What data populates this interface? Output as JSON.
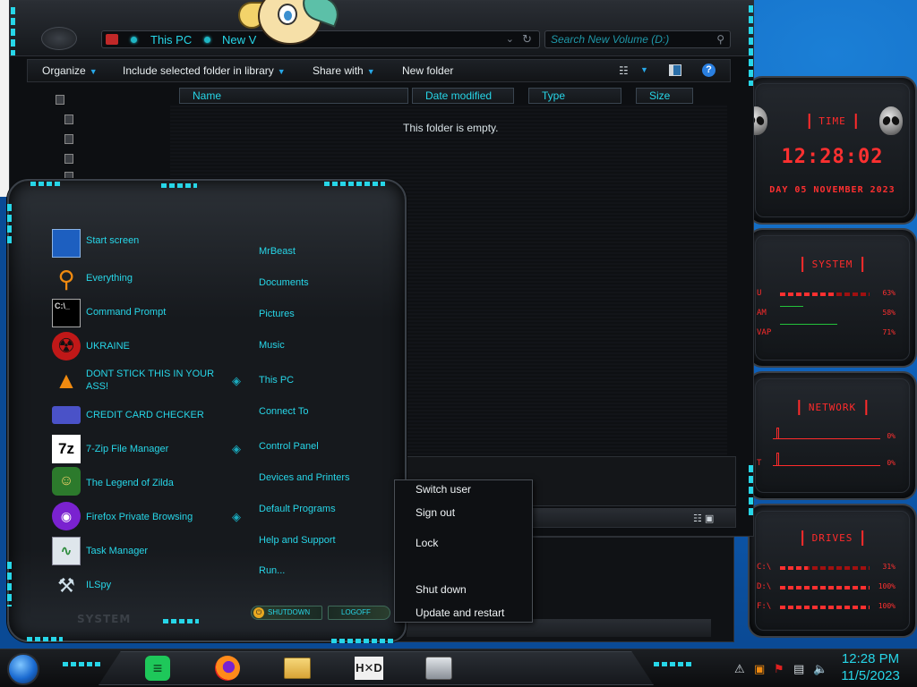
{
  "explorer": {
    "breadcrumb": [
      "This PC",
      "New V"
    ],
    "search_placeholder": "Search New Volume (D:)",
    "toolbar": {
      "organize": "Organize",
      "include_library": "Include selected folder in library",
      "share_with": "Share with",
      "new_folder": "New folder"
    },
    "columns": [
      "Name",
      "Date modified",
      "Type",
      "Size"
    ],
    "empty_message": "This folder is empty."
  },
  "start_menu": {
    "programs": [
      {
        "label": "Start screen",
        "icon": "start-screen-icon"
      },
      {
        "label": "Everything",
        "icon": "magnifier-icon"
      },
      {
        "label": "Command Prompt",
        "icon": "cmd-icon"
      },
      {
        "label": "UKRAINE",
        "icon": "radiation-icon"
      },
      {
        "label": "DONT STICK THIS IN YOUR ASS!",
        "icon": "vlc-cone-icon"
      },
      {
        "label": "CREDIT CARD CHECKER",
        "icon": "credit-card-icon"
      },
      {
        "label": "7-Zip File Manager",
        "icon": "7zip-icon"
      },
      {
        "label": "The Legend of Zilda",
        "icon": "zelda-icon"
      },
      {
        "label": "Firefox Private Browsing",
        "icon": "firefox-private-icon"
      },
      {
        "label": "Task Manager",
        "icon": "task-manager-icon"
      },
      {
        "label": "ILSpy",
        "icon": "ilspy-icon"
      }
    ],
    "places": [
      "MrBeast",
      "Documents",
      "Pictures",
      "Music",
      "This PC",
      "Connect To",
      "Control Panel",
      "Devices and Printers",
      "Default Programs",
      "Help and Support",
      "Run..."
    ],
    "system_label": "SYSTEM",
    "shutdown_label": "SHUTDOWN",
    "logoff_label": "LOGOFF"
  },
  "context_menu": {
    "items": [
      "Switch user",
      "Sign out",
      "Lock",
      "Shut down",
      "Update and restart"
    ]
  },
  "gadgets": {
    "time": {
      "title": "TIME",
      "clock": "12:28:02",
      "date": "DAY 05 NOVEMBER 2023"
    },
    "system": {
      "title": "SYSTEM",
      "rows": [
        {
          "label": "U",
          "pct_text": "63%",
          "value": 0.63
        },
        {
          "label": "AM",
          "pct_text": "58%",
          "value": 0.58
        },
        {
          "label": "VAP",
          "pct_text": "71%",
          "value": 0.71
        }
      ]
    },
    "network": {
      "title": "NETWORK",
      "rows": [
        {
          "pct_text": "0%"
        },
        {
          "label": "T",
          "pct_text": "0%"
        }
      ]
    },
    "drives": {
      "title": "DRIVES",
      "rows": [
        {
          "label": "C:\\",
          "pct_text": "31%",
          "value": 0.31
        },
        {
          "label": "D:\\",
          "pct_text": "100%",
          "value": 1.0
        },
        {
          "label": "F:\\",
          "pct_text": "100%",
          "value": 1.0
        }
      ]
    }
  },
  "taskbar": {
    "time": "12:28 PM",
    "date": "11/5/2023"
  },
  "colors": {
    "accent_cyan": "#27d6e8",
    "gadget_red": "#ff2b2b",
    "desktop_blue": "#0e5fb8"
  }
}
